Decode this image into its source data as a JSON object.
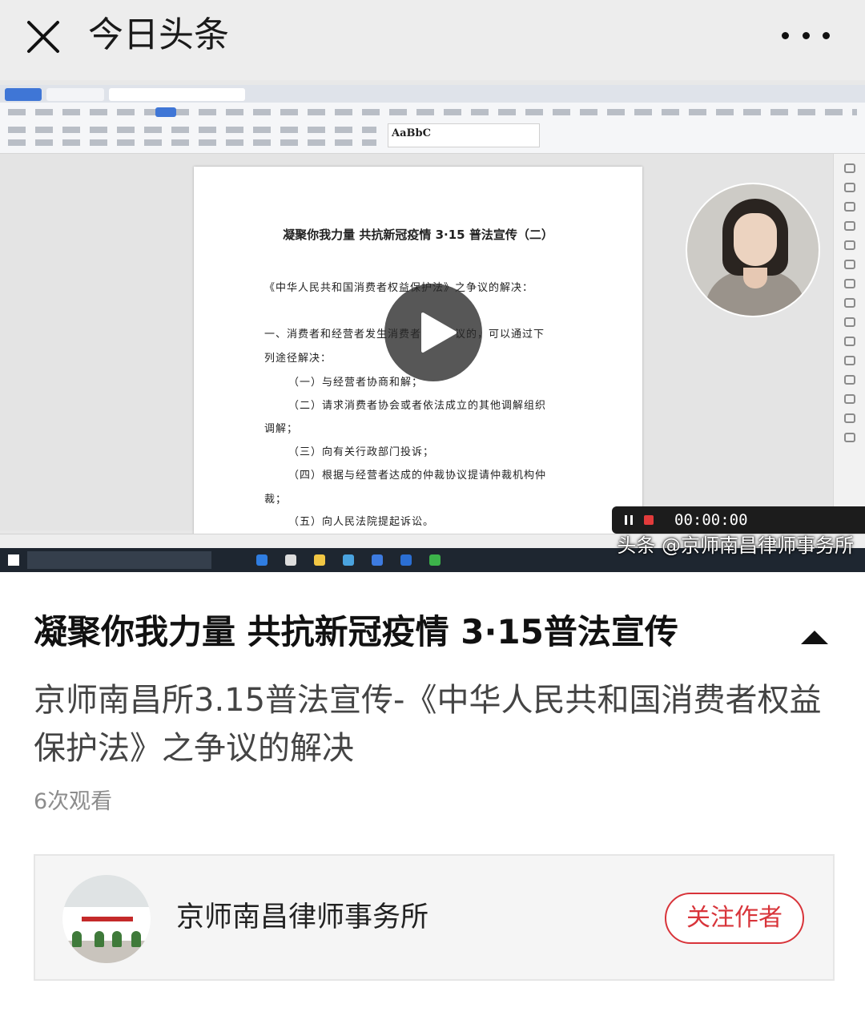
{
  "nav": {
    "title": "今日头条",
    "close_icon": "close-icon",
    "more_icon": "more-dots-icon"
  },
  "video": {
    "doc_title": "凝聚你我力量  共抗新冠疫情  3·15 普法宣传（二）",
    "doc_lines": [
      "《中华人民共和国消费者权益保护法》之争议的解决：",
      "一、消费者和经营者发生消费者权益争议的，可以通过下",
      "列途径解决：",
      "（一）与经营者协商和解；",
      "（二）请求消费者协会或者依法成立的其他调解组织",
      "调解；",
      "（三）向有关行政部门投诉；",
      "（四）根据与经营者达成的仲裁协议提请仲裁机构仲",
      "裁；",
      "（五）向人民法院提起诉讼。"
    ],
    "recording_time": "00:00:00",
    "watermark": "头条 @京师南昌律师事务所",
    "play_icon": "play-icon"
  },
  "article": {
    "title": "凝聚你我力量 共抗新冠疫情 3·15普法宣传",
    "description": "京师南昌所3.15普法宣传-《中华人民共和国消费者权益保护法》之争议的解决",
    "views": "6次观看",
    "collapse_icon": "collapse-up-icon"
  },
  "author": {
    "name": "京师南昌律师事务所",
    "follow_label": "关注作者"
  },
  "colors": {
    "accent": "#d8343a",
    "topbar_bg": "#ededed",
    "card_bg": "#f5f5f5"
  }
}
